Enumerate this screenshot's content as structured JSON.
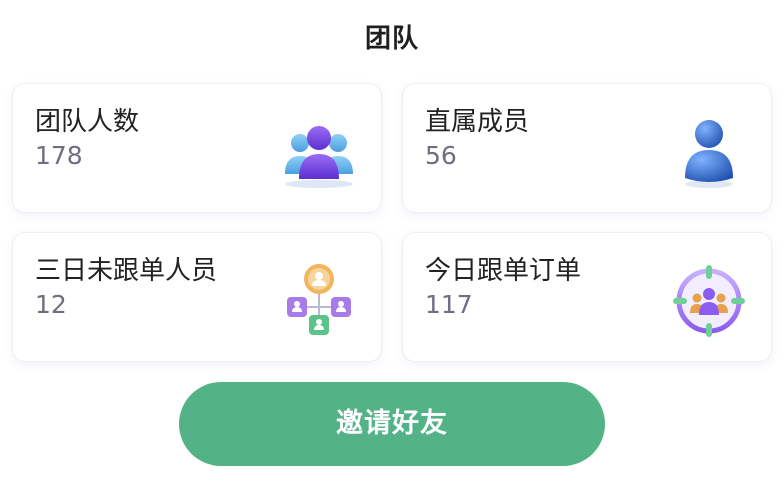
{
  "header": {
    "title": "团队"
  },
  "stats": [
    {
      "label": "团队人数",
      "value": "178",
      "icon": "team-group-icon"
    },
    {
      "label": "直属成员",
      "value": "56",
      "icon": "member-person-icon"
    },
    {
      "label": "三日未跟单人员",
      "value": "12",
      "icon": "org-hierarchy-icon"
    },
    {
      "label": "今日跟单订单",
      "value": "117",
      "icon": "target-group-icon"
    }
  ],
  "invite_button": {
    "label": "邀请好友"
  },
  "colors": {
    "accent_green": "#53b386",
    "value_gray": "#6e6f80",
    "icon_purple": "#7b4fe0",
    "icon_blue": "#5ba8e8",
    "icon_orange": "#e8a04a"
  }
}
